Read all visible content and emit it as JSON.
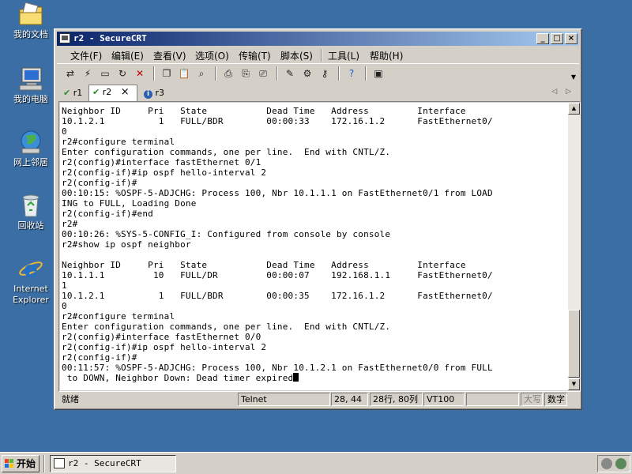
{
  "desktop": {
    "icons": [
      {
        "label": "我的文档",
        "icon": "folder-documents-icon"
      },
      {
        "label": "我的电脑",
        "icon": "computer-icon"
      },
      {
        "label": "网上邻居",
        "icon": "network-icon"
      },
      {
        "label": "回收站",
        "icon": "recycle-bin-icon"
      },
      {
        "label": "Internet Explorer",
        "line1": "Internet",
        "line2": "Explorer",
        "icon": "internet-explorer-icon"
      }
    ]
  },
  "window": {
    "title": "r2 - SecureCRT",
    "controls": {
      "minimize": "_",
      "maximize": "□",
      "close": "×"
    },
    "menu": [
      "文件(F)",
      "编辑(E)",
      "查看(V)",
      "选项(O)",
      "传输(T)",
      "脚本(S)",
      "工具(L)",
      "帮助(H)"
    ],
    "toolbar_icons": [
      "connect-icon",
      "quick-connect-icon",
      "connect-tab-icon",
      "reconnect-icon",
      "disconnect-icon",
      "copy-icon",
      "paste-icon",
      "find-icon",
      "print-icon",
      "print-selection-icon",
      "print-setup-icon",
      "session-options-icon",
      "global-options-icon",
      "keymap-icon",
      "help-icon",
      "sftp-icon"
    ],
    "tabs": [
      {
        "label": "r1",
        "status": "connected"
      },
      {
        "label": "r2",
        "status": "connected",
        "active": true,
        "close": "×"
      },
      {
        "label": "r3",
        "status": "info"
      }
    ],
    "tab_nav": {
      "prev": "◁",
      "next": "▷"
    },
    "terminal_lines": [
      "Neighbor ID     Pri   State           Dead Time   Address         Interface",
      "10.1.2.1          1   FULL/BDR        00:00:33    172.16.1.2      FastEthernet0/",
      "0",
      "r2#configure terminal",
      "Enter configuration commands, one per line.  End with CNTL/Z.",
      "r2(config)#interface fastEthernet 0/1",
      "r2(config-if)#ip ospf hello-interval 2",
      "r2(config-if)#",
      "00:10:15: %OSPF-5-ADJCHG: Process 100, Nbr 10.1.1.1 on FastEthernet0/1 from LOAD",
      "ING to FULL, Loading Done",
      "r2(config-if)#end",
      "r2#",
      "00:10:26: %SYS-5-CONFIG_I: Configured from console by console",
      "r2#show ip ospf neighbor",
      "",
      "Neighbor ID     Pri   State           Dead Time   Address         Interface",
      "10.1.1.1         10   FULL/DR         00:00:07    192.168.1.1     FastEthernet0/",
      "1",
      "10.1.2.1          1   FULL/BDR        00:00:35    172.16.1.2      FastEthernet0/",
      "0",
      "r2#configure terminal",
      "Enter configuration commands, one per line.  End with CNTL/Z.",
      "r2(config)#interface fastEthernet 0/0",
      "r2(config-if)#ip ospf hello-interval 2",
      "r2(config-if)#",
      "00:11:57: %OSPF-5-ADJCHG: Process 100, Nbr 10.1.2.1 on FastEthernet0/0 from FULL",
      " to DOWN, Neighbor Down: Dead timer expired"
    ],
    "scrollbar": {
      "up": "▲",
      "down": "▼"
    },
    "status": {
      "ready": "就绪",
      "protocol": "Telnet",
      "cursor_pos": "28, 44",
      "size": "28行, 80列",
      "emulation": "VT100",
      "caps": "大写",
      "num": "数字"
    }
  },
  "taskbar": {
    "start_label": "开始",
    "task_label": "r2 - SecureCRT",
    "tray_icons": [
      "volume-icon",
      "network-tray-icon"
    ]
  },
  "colors": {
    "desktop": "#3a6ea5",
    "titlebar_start": "#0a246a",
    "titlebar_end": "#a6caf0",
    "chrome": "#d4d0c8"
  }
}
